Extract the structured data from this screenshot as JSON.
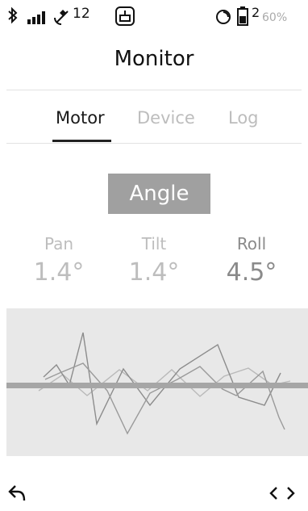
{
  "status_bar": {
    "bluetooth_icon": "bluetooth-icon",
    "signal_icon": "signal-bars-icon",
    "gps_count": "12",
    "gps_icon": "gps-satellite-icon",
    "gimbal_icon": "gimbal-icon",
    "sync_icon": "sync-icon",
    "battery_icon": "battery-icon",
    "battery_count": "2",
    "battery_percent": "60%"
  },
  "header": {
    "title": "Monitor"
  },
  "tabs": [
    {
      "label": "Motor",
      "active": true
    },
    {
      "label": "Device",
      "active": false
    },
    {
      "label": "Log",
      "active": false
    }
  ],
  "angle_badge": "Angle",
  "axes": [
    {
      "label": "Pan",
      "value": "1.4°"
    },
    {
      "label": "Tilt",
      "value": "1.4°"
    },
    {
      "label": "Roll",
      "value": "4.5°"
    }
  ],
  "footer": {
    "back_icon": "back-arrow-icon",
    "code_icon": "code-brackets-icon"
  },
  "colors": {
    "graph_bg": "#e8e8e8",
    "baseline": "#a6a6a6",
    "badge_bg": "#a0a0a0",
    "inactive_text": "#bdbdbd"
  }
}
